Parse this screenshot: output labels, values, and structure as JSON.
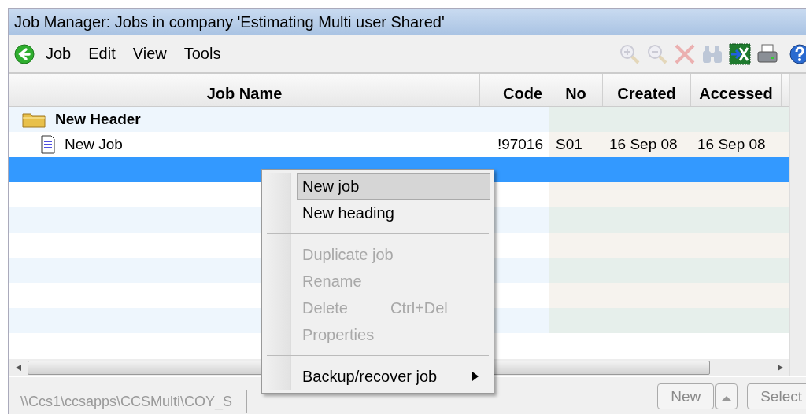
{
  "window": {
    "title": "Job Manager: Jobs in company 'Estimating Multi user Shared'"
  },
  "menu": [
    "Job",
    "Edit",
    "View",
    "Tools"
  ],
  "toolbar": [
    {
      "kind": "zoom-in",
      "disabled": true
    },
    {
      "kind": "zoom-out",
      "disabled": true
    },
    {
      "kind": "delete",
      "disabled": true
    },
    {
      "kind": "find",
      "disabled": true
    },
    {
      "kind": "export",
      "disabled": false
    },
    {
      "kind": "print",
      "disabled": false
    },
    {
      "kind": "help",
      "disabled": false
    }
  ],
  "table": {
    "columns": [
      "Job Name",
      "Code",
      "No",
      "Created",
      "Accessed"
    ],
    "rows": [
      {
        "kind": "header",
        "name": "New Header",
        "selected": false
      },
      {
        "kind": "job",
        "name": "New Job",
        "code": "!97016",
        "no": "S01",
        "created": "16 Sep 08",
        "accessed": "16 Sep 08",
        "selected": false
      },
      {
        "kind": "blank",
        "selected": true
      },
      {
        "kind": "blank",
        "selected": false
      },
      {
        "kind": "blank",
        "selected": false
      },
      {
        "kind": "blank",
        "selected": false
      },
      {
        "kind": "blank",
        "selected": false
      },
      {
        "kind": "blank",
        "selected": false
      },
      {
        "kind": "blank",
        "selected": false
      }
    ]
  },
  "context_menu": [
    {
      "kind": "item",
      "label": "New job",
      "selected": true,
      "disabled": false
    },
    {
      "kind": "item",
      "label": "New heading",
      "selected": false,
      "disabled": false
    },
    {
      "kind": "separator"
    },
    {
      "kind": "item",
      "label": "Duplicate job",
      "selected": false,
      "disabled": true
    },
    {
      "kind": "item",
      "label": "Rename",
      "selected": false,
      "disabled": true
    },
    {
      "kind": "item",
      "label": "Delete",
      "shortcut": "Ctrl+Del",
      "selected": false,
      "disabled": true
    },
    {
      "kind": "item",
      "label": "Properties",
      "selected": false,
      "disabled": true
    },
    {
      "kind": "separator"
    },
    {
      "kind": "submenu",
      "label": "Backup/recover job",
      "selected": false,
      "disabled": false
    }
  ],
  "status_bar": {
    "path": "\\\\Ccs1\\ccsapps\\CCSMulti\\COY_S",
    "buttons": [
      {
        "kind": "text",
        "label": "New",
        "disabled": true
      },
      {
        "kind": "arrow"
      },
      {
        "kind": "text",
        "label": "Select",
        "disabled": true
      }
    ]
  }
}
